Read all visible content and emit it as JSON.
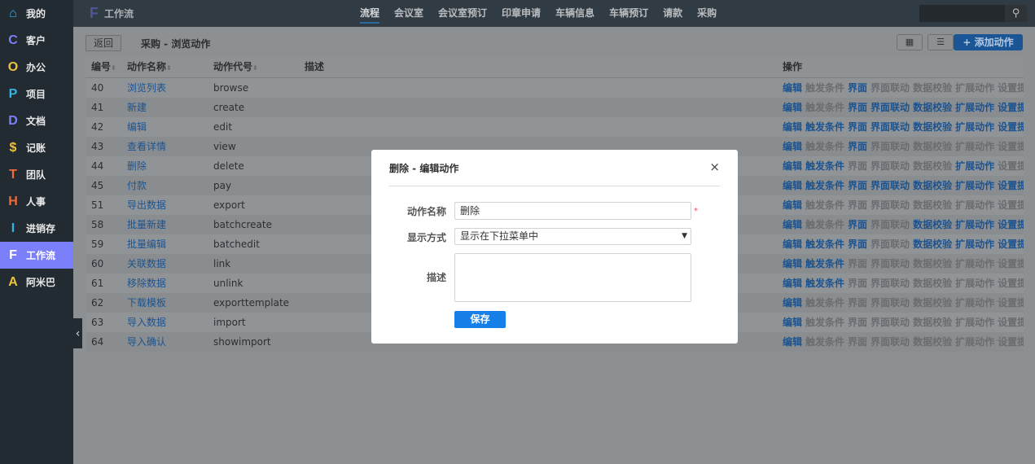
{
  "sidebar": {
    "items": [
      {
        "icon": "⌂",
        "label": "我的",
        "color": "#2fb4e8"
      },
      {
        "icon": "C",
        "label": "客户",
        "color": "#7b7ffa"
      },
      {
        "icon": "O",
        "label": "办公",
        "color": "#f0c23a"
      },
      {
        "icon": "P",
        "label": "项目",
        "color": "#2fb4e8"
      },
      {
        "icon": "D",
        "label": "文档",
        "color": "#7b7ffa"
      },
      {
        "icon": "$",
        "label": "记账",
        "color": "#f0c23a"
      },
      {
        "icon": "T",
        "label": "团队",
        "color": "#f06b3a"
      },
      {
        "icon": "H",
        "label": "人事",
        "color": "#f06b3a"
      },
      {
        "icon": "I",
        "label": "进销存",
        "color": "#2fb4e8"
      },
      {
        "icon": "F",
        "label": "工作流",
        "color": "#ffffff"
      },
      {
        "icon": "A",
        "label": "阿米巴",
        "color": "#f0c23a"
      }
    ],
    "collapse": "‹"
  },
  "topbar": {
    "app_icon": "F",
    "app_title": "工作流",
    "nav": [
      "流程",
      "会议室",
      "会议室预订",
      "印章申请",
      "车辆信息",
      "车辆预订",
      "请款",
      "采购"
    ],
    "search_icon": "⚲"
  },
  "toolbar": {
    "back": "返回",
    "breadcrumb": "采购 - 浏览动作",
    "grid_icon": "▦",
    "list_icon": "☰",
    "add": "+ 添加动作"
  },
  "table": {
    "headers": [
      "编号",
      "动作名称",
      "动作代号",
      "描述",
      "操作"
    ],
    "sort_icon": "⬍",
    "ops": [
      "编辑",
      "触发条件",
      "界面",
      "界面联动",
      "数据校验",
      "扩展动作",
      "设置提"
    ],
    "rows": [
      {
        "id": "40",
        "name": "浏览列表",
        "code": "browse",
        "ops": [
          1,
          0,
          1,
          0,
          0,
          0,
          0
        ]
      },
      {
        "id": "41",
        "name": "新建",
        "code": "create",
        "ops": [
          1,
          0,
          1,
          1,
          1,
          1,
          1
        ]
      },
      {
        "id": "42",
        "name": "编辑",
        "code": "edit",
        "ops": [
          1,
          1,
          1,
          1,
          1,
          1,
          1
        ]
      },
      {
        "id": "43",
        "name": "查看详情",
        "code": "view",
        "ops": [
          1,
          0,
          1,
          0,
          0,
          0,
          0
        ]
      },
      {
        "id": "44",
        "name": "删除",
        "code": "delete",
        "ops": [
          1,
          1,
          0,
          0,
          0,
          1,
          0
        ]
      },
      {
        "id": "45",
        "name": "付款",
        "code": "pay",
        "ops": [
          1,
          1,
          1,
          1,
          1,
          1,
          1
        ]
      },
      {
        "id": "51",
        "name": "导出数据",
        "code": "export",
        "ops": [
          1,
          0,
          0,
          0,
          0,
          0,
          0
        ]
      },
      {
        "id": "58",
        "name": "批量新建",
        "code": "batchcreate",
        "ops": [
          1,
          0,
          1,
          0,
          1,
          1,
          1
        ]
      },
      {
        "id": "59",
        "name": "批量编辑",
        "code": "batchedit",
        "ops": [
          1,
          1,
          1,
          0,
          1,
          1,
          1
        ]
      },
      {
        "id": "60",
        "name": "关联数据",
        "code": "link",
        "ops": [
          1,
          1,
          0,
          0,
          0,
          0,
          0
        ]
      },
      {
        "id": "61",
        "name": "移除数据",
        "code": "unlink",
        "ops": [
          1,
          1,
          0,
          0,
          0,
          0,
          0
        ]
      },
      {
        "id": "62",
        "name": "下载模板",
        "code": "exporttemplate",
        "ops": [
          1,
          0,
          0,
          0,
          0,
          0,
          0
        ]
      },
      {
        "id": "63",
        "name": "导入数据",
        "code": "import",
        "ops": [
          1,
          0,
          0,
          0,
          0,
          0,
          0
        ]
      },
      {
        "id": "64",
        "name": "导入确认",
        "code": "showimport",
        "ops": [
          1,
          0,
          0,
          0,
          0,
          0,
          0
        ]
      }
    ]
  },
  "modal": {
    "title": "删除 - 编辑动作",
    "close": "×",
    "name_label": "动作名称",
    "name_value": "删除",
    "required": "*",
    "display_label": "显示方式",
    "display_value": "显示在下拉菜单中",
    "dropdown_icon": "▼",
    "desc_label": "描述",
    "desc_value": "",
    "save": "保存"
  }
}
